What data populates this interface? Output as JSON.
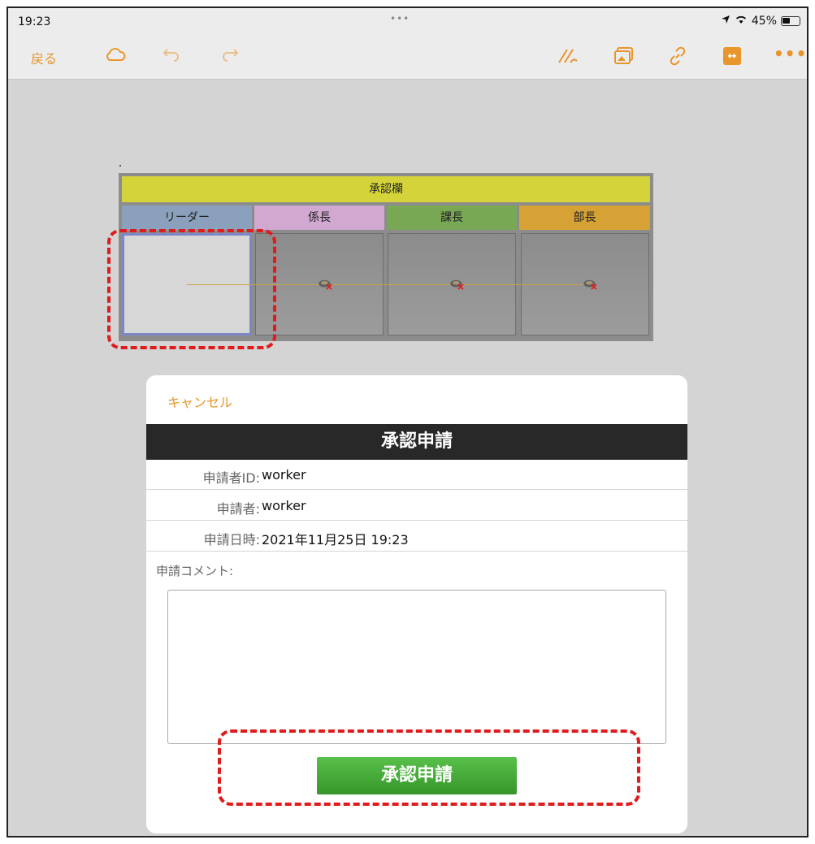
{
  "status_bar": {
    "time": "19:23",
    "dots": "•••",
    "battery_percent": "45%"
  },
  "toolbar": {
    "back_label": "戻る",
    "more_label": "•••",
    "accent_color": "#e8952b"
  },
  "approval_table": {
    "title": "承認欄",
    "roles": [
      "リーダー",
      "係長",
      "課長",
      "部長"
    ]
  },
  "dialog": {
    "cancel_label": "キャンセル",
    "title": "承認申請",
    "rows": [
      {
        "label": "申請者ID:",
        "value": "worker"
      },
      {
        "label": "申請者:",
        "value": "worker"
      },
      {
        "label": "申請日時:",
        "value": "2021年11月25日 19:23"
      }
    ],
    "comment_label": "申請コメント:",
    "comment_value": "",
    "submit_label": "承認申請"
  }
}
